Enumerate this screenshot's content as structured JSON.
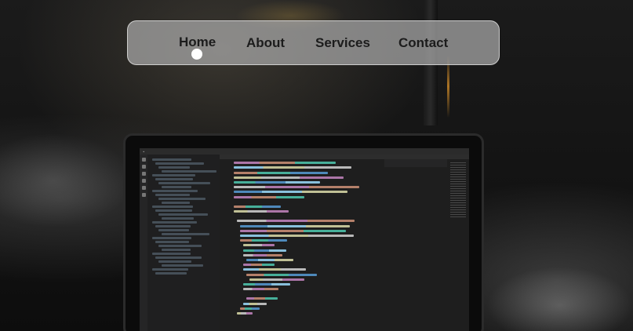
{
  "nav": {
    "items": [
      {
        "label": "Home",
        "active": true
      },
      {
        "label": "About",
        "active": false
      },
      {
        "label": "Services",
        "active": false
      },
      {
        "label": "Contact",
        "active": false
      }
    ],
    "active_indicator_color": "#ffffff",
    "bar_color": "#aaaaaa",
    "text_color": "#1c1c1c"
  },
  "background": {
    "description_icon": "laptop-code-editor-photo"
  }
}
